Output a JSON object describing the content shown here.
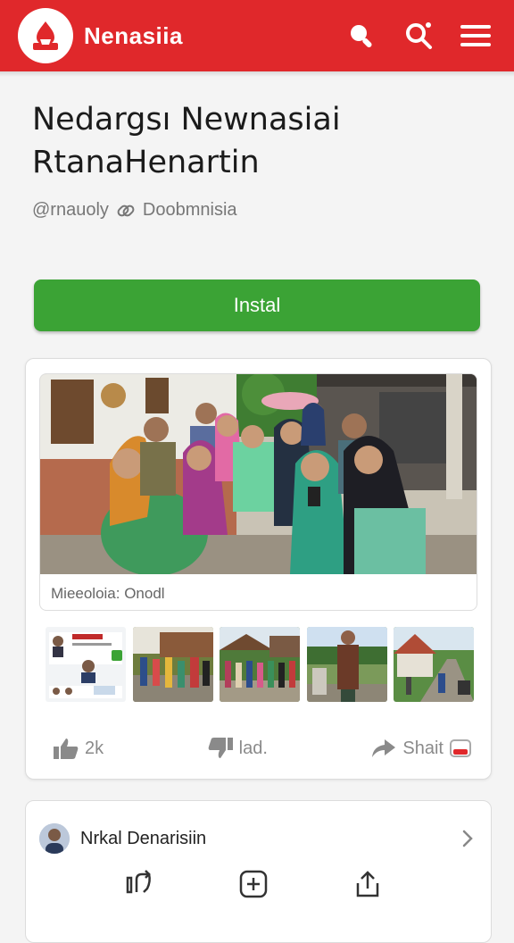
{
  "app": {
    "brand": "Nenasiia"
  },
  "article": {
    "title_line1": "Nedargsı Newnasiai",
    "title_line2": "RtanaHenartin",
    "byline_author": "@rnauoly",
    "byline_source": "Doobmnisia"
  },
  "install_label": "Instal",
  "media": {
    "caption": "Mieeoloia: Onodl",
    "thumbnails": [
      "news-screenshot",
      "village-street",
      "village-crowd",
      "man-portrait",
      "village-road"
    ]
  },
  "actions": {
    "like_count": "2k",
    "dislike_label": "lad.",
    "share_label": "Shait"
  },
  "related": {
    "author": "Nrkal Denarisiin"
  },
  "colors": {
    "brand_red": "#e0282b",
    "install_green": "#3ba335"
  }
}
